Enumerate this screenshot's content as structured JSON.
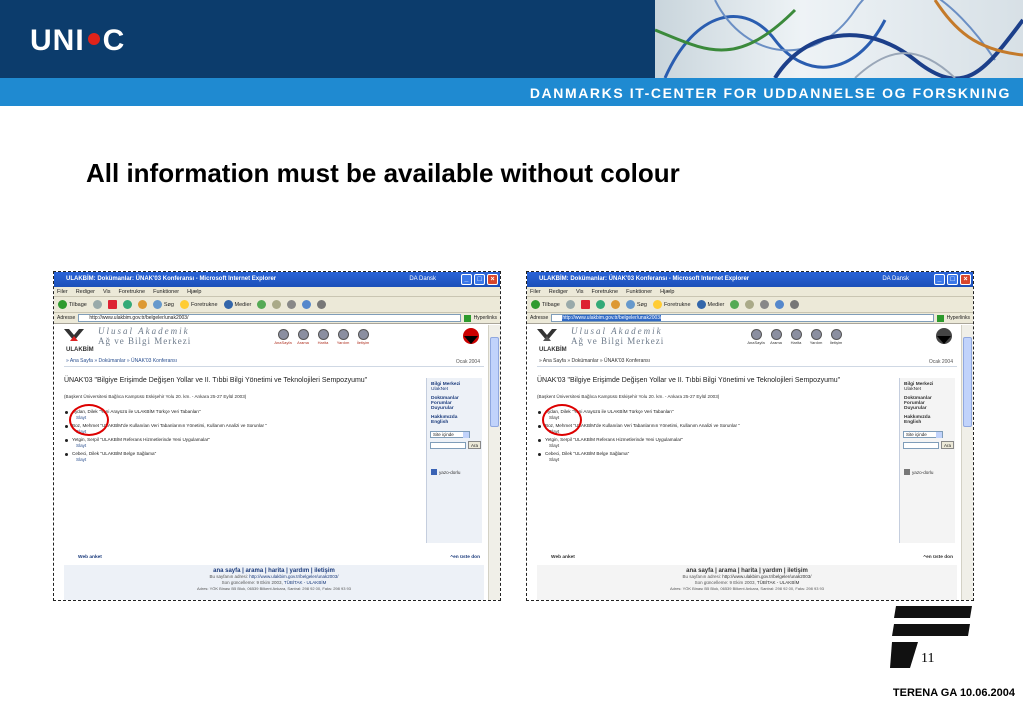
{
  "header": {
    "logo": "UNI C",
    "tagline": "DANMARKS IT-CENTER FOR UDDANNELSE OG FORSKNING"
  },
  "slide": {
    "title": "All information must be available without colour",
    "page_number": "11",
    "footer": "TERENA GA 10.06.2004"
  },
  "colors": {
    "brand_dark": "#0c3c6c",
    "brand_band": "#1f8ad1",
    "highlight_circle": "#dd0000"
  },
  "browser": {
    "window_title": "ULAKBİM: Dokümanlar: ÜNAK'03 Konferansı - Microsoft Internet Explorer",
    "lang": "DA Dansk",
    "menu": [
      "Filer",
      "Rediger",
      "Vis",
      "Foretrukne",
      "Funktioner",
      "Hjælp"
    ],
    "toolbar": {
      "back": "Tilbage",
      "search": "Søg",
      "favorites": "Foretrukne",
      "media": "Medier"
    },
    "address_label": "Adresse",
    "url": "http://www.ulakbim.gov.tr/belgeler/unak2003/",
    "links_label": "Hyperlinks"
  },
  "site": {
    "name_line1": "Ulusal Akademik",
    "name_line2": "Ağ ve Bilgi Merkezi",
    "abbr": "ULAKBİM",
    "nav": [
      "AnaSayfa",
      "Arama",
      "Harita",
      "Yardım",
      "İletişim"
    ],
    "date": "Ocak 2004",
    "breadcrumb": "» Ana Sayfa » Dokümanlar » ÜNAK'03 Konferansı",
    "conf_title": "ÜNAK'03 \"Bilgiye Erişimde Değişen Yollar ve II. Tıbbi Bilgi Yönetimi ve Teknolojileri Sempozyumu\"",
    "conf_sub": "(Başkent Üniversitesi Bağlıca Kampüsü Eskişehir Yolu 20. km. - Ankara 25-27 Eylül 2003)",
    "items": [
      {
        "text": "Aydan, Dilek \"Yeni Arayüzü ile ULAKBİM Türkçe Veri Tabanları\"",
        "link": "Slayt"
      },
      {
        "text": "Boz, Mehmet \"ULAKBİM'de Kullanılan Veri Tabanlarının Yönetimi, Kullanım Analizi ve Sorunlar \"",
        "link": "Slayt"
      },
      {
        "text": "Yetgin, Serpil \"ULAKBİM Referans Hizmetlerinde Yeni Uygulamalar\"",
        "link": "Slayt"
      },
      {
        "text": "Cebeci, Dilek \"ULAKBİM Belge Sağlama\"",
        "link": "Slayt"
      }
    ],
    "panel": {
      "g1": [
        "Bilgi Merkezi",
        "UlakNet"
      ],
      "g2": [
        "Dokümanlar",
        "Forumlar",
        "Duyurular"
      ],
      "g3": [
        "Hakkımızda",
        "English"
      ],
      "search_scope": "Site içinde",
      "search_button": "Ara",
      "dict": "yazo-dorlu"
    },
    "web_anket": "Web anket",
    "top_link": "^en üste don",
    "footer_links": "ana sayfa | arama | harita | yardım | iletişim",
    "footer_line1_prefix": "Bu sayfanın adresi:",
    "footer_line1_url": "http://www.ulakbim.gov.tr/belgeler/unak2003/",
    "footer_line2_prefix": "Son güncelleme: 9 Ekim 2003,",
    "footer_line2_org": "TÜBİTAK - ULAKBİM",
    "footer_line3": "Adres: YÖK Binası B5 Blok, 06539 Bilkent Ankara, Santral: 298 92 00, Faks: 298 93 93"
  }
}
